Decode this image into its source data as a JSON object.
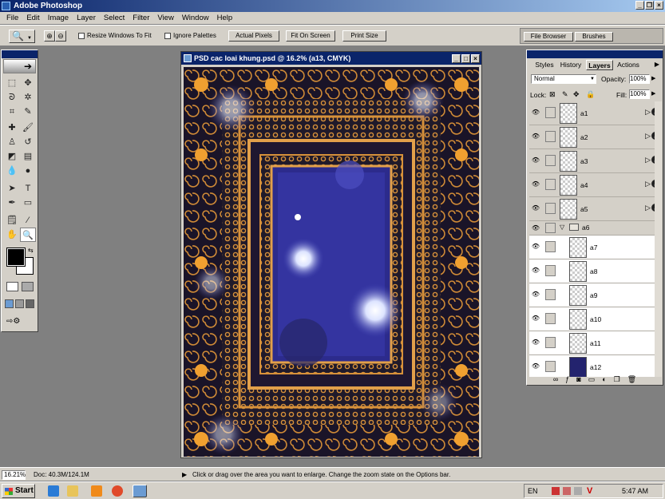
{
  "app": {
    "title": "Adobe Photoshop"
  },
  "menu": [
    "File",
    "Edit",
    "Image",
    "Layer",
    "Select",
    "Filter",
    "View",
    "Window",
    "Help"
  ],
  "options": {
    "resize_windows": "Resize Windows To Fit",
    "ignore_palettes": "Ignore Palettes",
    "actual_pixels": "Actual Pixels",
    "fit_on_screen": "Fit On Screen",
    "print_size": "Print Size",
    "file_browser": "File Browser",
    "brushes": "Brushes"
  },
  "document": {
    "title": "PSD cac loai khung.psd @ 16.2% (a13, CMYK)"
  },
  "layers_panel": {
    "tabs": [
      "Styles",
      "History",
      "Layers",
      "Actions"
    ],
    "active_tab": "Layers",
    "blend_mode": "Normal",
    "opacity_label": "Opacity:",
    "opacity": "100%",
    "lock_label": "Lock:",
    "fill_label": "Fill:",
    "fill": "100%",
    "layers": [
      {
        "name": "a1",
        "effects": true
      },
      {
        "name": "a2",
        "effects": true
      },
      {
        "name": "a3",
        "effects": true
      },
      {
        "name": "a4",
        "effects": true
      },
      {
        "name": "a5",
        "effects": true
      },
      {
        "name": "a6",
        "group": true
      },
      {
        "name": "a7"
      },
      {
        "name": "a8"
      },
      {
        "name": "a9"
      },
      {
        "name": "a10"
      },
      {
        "name": "a11"
      },
      {
        "name": "a12"
      }
    ]
  },
  "status": {
    "zoom": "16.21%",
    "doc": "Doc: 40.3M/124.1M",
    "hint": "Click or drag over the area you want to enlarge. Change the zoom state on the Options bar."
  },
  "taskbar": {
    "start": "Start",
    "lang": "EN",
    "time": "5:47 AM"
  },
  "colors": {
    "titlebar": "#0a246a",
    "chrome": "#d4d0c8",
    "workspace": "#808080",
    "canvas_blue": "#2a2a8a",
    "frame_gold": "#d7913a"
  }
}
